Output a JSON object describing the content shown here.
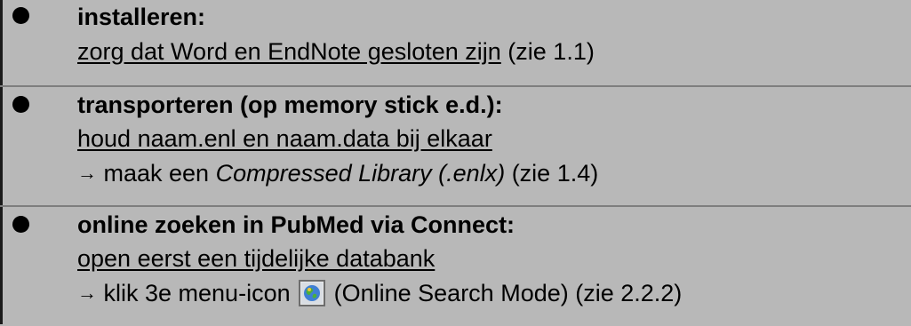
{
  "items": [
    {
      "heading": "installeren:",
      "instruction": "zorg dat Word en EndNote gesloten zijn",
      "ref": " (zie 1.1)"
    },
    {
      "heading": "transporteren (op memory stick e.d.):",
      "instruction": "houd naam.enl en naam.data bij elkaar",
      "step": {
        "arrow": "→",
        "pre": " maak een ",
        "emph": "Compressed Library (.enlx)",
        "post": " (zie 1.4)"
      }
    },
    {
      "heading": "online zoeken in PubMed via Connect:",
      "instruction": "open eerst een tijdelijke databank",
      "step": {
        "arrow": "→",
        "pre": " klik 3e menu-icon ",
        "icon": "online-search-globe-icon",
        "post": " (Online Search Mode) (zie 2.2.2)"
      }
    }
  ]
}
